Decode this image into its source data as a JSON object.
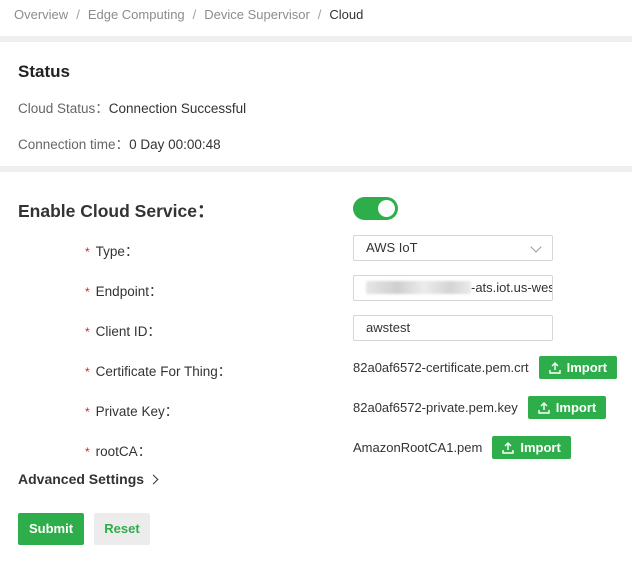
{
  "breadcrumb": {
    "items": [
      "Overview",
      "Edge Computing",
      "Device Supervisor"
    ],
    "current": "Cloud",
    "separator": "/"
  },
  "status": {
    "title": "Status",
    "cloud_status_label": "Cloud Status：",
    "cloud_status_value": "Connection Successful",
    "connection_time_label": "Connection time：",
    "connection_time_value": "0 Day 00:00:48"
  },
  "cloud_service": {
    "enable_label": "Enable Cloud Service：",
    "enabled": true,
    "required_mark": "*",
    "type": {
      "label": "Type：",
      "value": "AWS IoT"
    },
    "endpoint": {
      "label": "Endpoint：",
      "value": "-ats.iot.us-wes"
    },
    "client_id": {
      "label": "Client ID：",
      "value": "awstest"
    },
    "certificate": {
      "label": "Certificate For Thing：",
      "file": "82a0af6572-certificate.pem.crt",
      "button": "Import"
    },
    "private_key": {
      "label": "Private Key：",
      "file": "82a0af6572-private.pem.key",
      "button": "Import"
    },
    "root_ca": {
      "label": "rootCA：",
      "file": "AmazonRootCA1.pem",
      "button": "Import"
    }
  },
  "advanced_settings": "Advanced Settings",
  "actions": {
    "submit": "Submit",
    "reset": "Reset"
  },
  "colors": {
    "accent": "#2eae4a",
    "required": "#e02020",
    "band": "#efefef"
  }
}
